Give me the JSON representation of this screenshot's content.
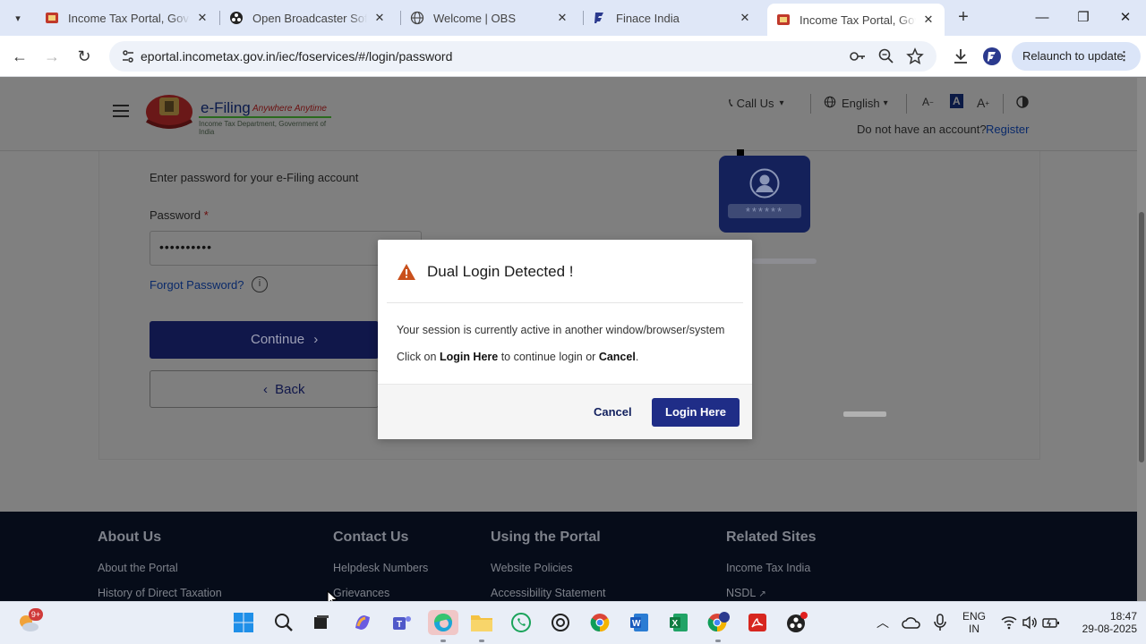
{
  "browser": {
    "tabs": [
      {
        "title": "Income Tax Portal, Government of India",
        "active": false
      },
      {
        "title": "Open Broadcaster Software",
        "active": false
      },
      {
        "title": "Welcome | OBS",
        "active": false
      },
      {
        "title": "Finace India",
        "active": false
      },
      {
        "title": "Income Tax Portal, Government of India",
        "active": true
      }
    ],
    "url": "eportal.incometax.gov.in/iec/foservices/#/login/password",
    "relaunch_label": "Relaunch to update"
  },
  "header": {
    "logo_title": "e-Filing",
    "logo_tagline": "Anywhere Anytime",
    "logo_subtitle": "Income Tax Department, Government of India",
    "call_us": "Call Us",
    "language": "English",
    "font_decrease": "A",
    "font_normal": "A",
    "font_increase": "A",
    "no_account_text": "Do not have an account?",
    "register_label": "Register"
  },
  "login": {
    "subtitle": "Enter password for your e-Filing account",
    "password_label": "Password",
    "required_mark": "*",
    "password_value": "••••••••••",
    "forgot_label": "Forgot Password?",
    "info_glyph": "i",
    "continue_label": "Continue",
    "back_label": "Back",
    "illustration_mask": "******"
  },
  "modal": {
    "title": "Dual Login Detected !",
    "message": "Your session is currently active in another window/browser/system",
    "instruction_prefix": "Click on ",
    "instruction_login": "Login Here",
    "instruction_middle": " to continue login or ",
    "instruction_cancel": "Cancel",
    "instruction_suffix": ".",
    "cancel_label": "Cancel",
    "login_label": "Login Here"
  },
  "footer": {
    "columns": [
      {
        "heading": "About Us",
        "links": [
          "About the Portal",
          "History of Direct Taxation"
        ]
      },
      {
        "heading": "Contact Us",
        "links": [
          "Helpdesk Numbers",
          "Grievances"
        ]
      },
      {
        "heading": "Using the Portal",
        "links": [
          "Website Policies",
          "Accessibility Statement"
        ]
      },
      {
        "heading": "Related Sites",
        "links": [
          "Income Tax India",
          "NSDL"
        ]
      }
    ]
  },
  "taskbar": {
    "widget_badge": "9+",
    "language_line1": "ENG",
    "language_line2": "IN",
    "time": "18:47",
    "date": "29-08-2025"
  },
  "colors": {
    "brand_navy": "#1f2d87",
    "warning": "#c9501c",
    "link": "#0a2a6a"
  }
}
